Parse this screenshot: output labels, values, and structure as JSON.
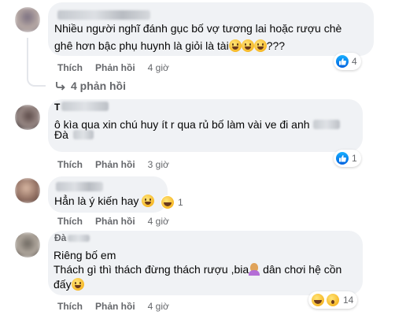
{
  "comments": [
    {
      "text_lines": [
        "Nhiều người nghĩ đánh gục bố vợ tương lai hoặc rượu chè",
        "ghê hơn bậc phụ huynh là giỏi là tài",
        "???"
      ],
      "like_label": "Thích",
      "reply_label": "Phản hồi",
      "time": "4 giờ",
      "reaction_count": "4",
      "reaction_icons": [
        "like-icon"
      ],
      "replies_label": "4 phản hồi"
    },
    {
      "name_fragment": "T",
      "text_lines": [
        "ô kìa qua xin chú huy ít r qua rủ bố làm vài ve đi anh",
        "Đà"
      ],
      "like_label": "Thích",
      "reply_label": "Phản hồi",
      "time": "3 giờ",
      "reaction_count": "1",
      "reaction_icons": [
        "like-icon"
      ]
    },
    {
      "text_lines": [
        "Hẳn là ý kiến hay"
      ],
      "like_label": "Thích",
      "reply_label": "Phản hồi",
      "time": "4 giờ",
      "reaction_count": "1",
      "reaction_icons": [
        "tongue-emoji-icon"
      ]
    },
    {
      "name_fragment": "Đà",
      "text_lines": [
        "Riêng bố em",
        "Thách gì thì thách đừng thách rượu ,bia",
        "dân chơi hệ cồn",
        "đấy"
      ],
      "like_label": "Thích",
      "reply_label": "Phản hồi",
      "time": "4 giờ",
      "reaction_count": "14",
      "reaction_icons": [
        "haha-icon",
        "wow-icon"
      ]
    }
  ],
  "colors": {
    "bubble": "#f0f2f5",
    "meta": "#65676b",
    "like_blue": "#0866ff"
  }
}
